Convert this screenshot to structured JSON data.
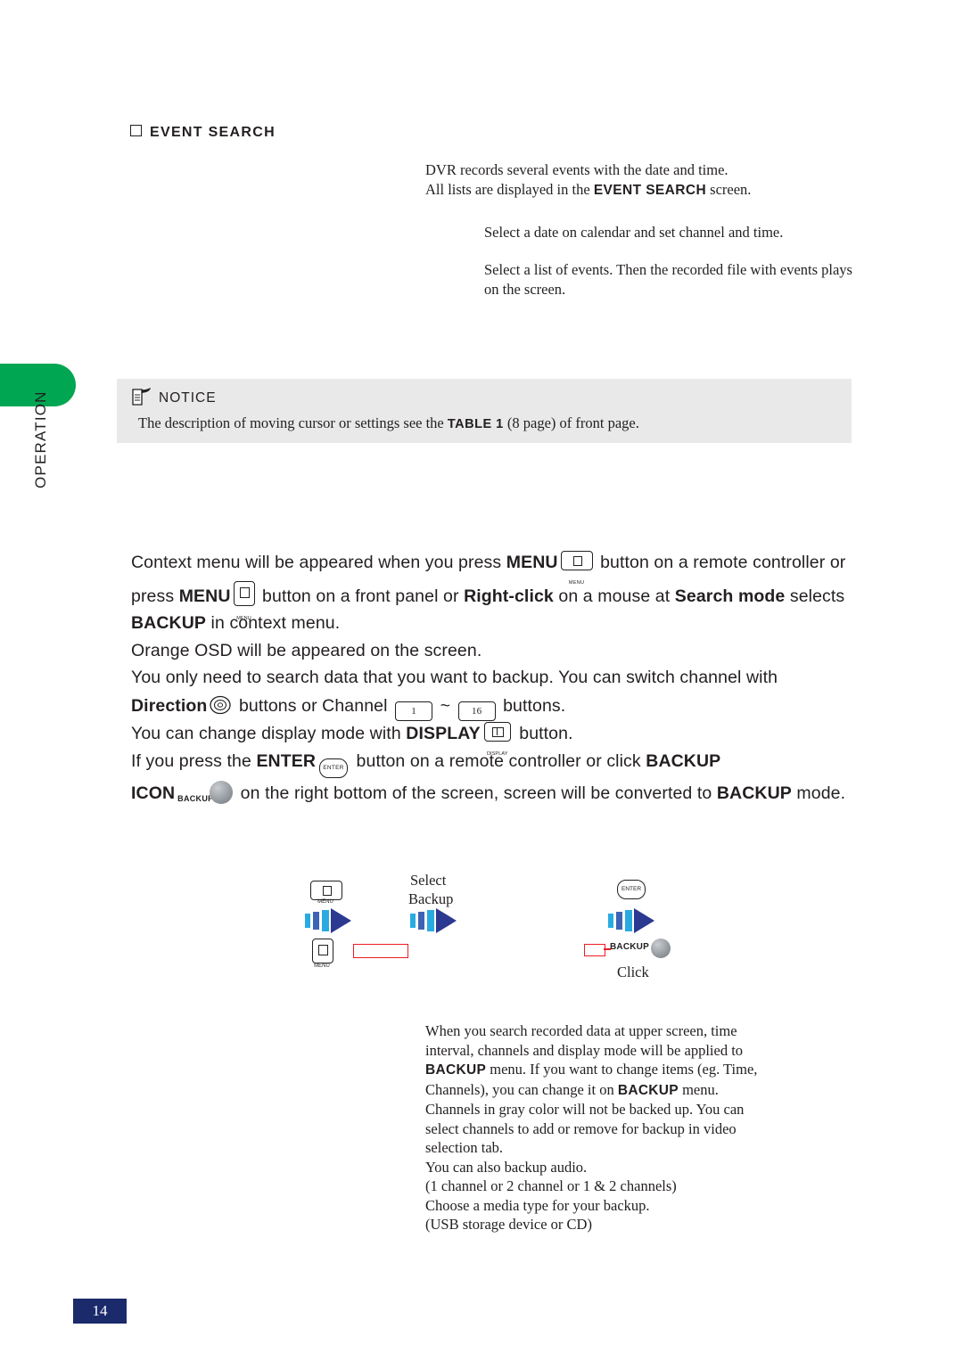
{
  "page": {
    "number": "14",
    "side_label": "OPERATION"
  },
  "section": {
    "heading": "EVENT SEARCH"
  },
  "intro": {
    "line1a": "DVR records several events with the date and time.",
    "line1b_pre": "All lists are displayed in the ",
    "line1b_bold": "EVENT SEARCH",
    "line1b_post": " screen.",
    "line2": "Select a date on calendar and set channel and time.",
    "line3": "Select a list of events. Then the recorded file with events plays on the screen."
  },
  "notice": {
    "title": "NOTICE",
    "text_pre": "The description of moving cursor or settings see the ",
    "text_bold": "TABLE 1",
    "text_post": " (8 page) of front page."
  },
  "body": {
    "seg1": "Context menu will be appeared when you press ",
    "menu_1": "MENU",
    "seg2": " button on a remote controller or press ",
    "menu_2": "MENU",
    "seg3": " button on a front panel or ",
    "rightclick": "Right-click",
    "seg4": " on a mouse at ",
    "searchmode": "Search mode",
    "seg5": " selects ",
    "backup_1": "BACKUP",
    "seg6": " in context menu.",
    "line_osd": "Orange OSD will be appeared on the screen.",
    "seg7": "You only need to search data that you want to backup. You can switch channel with ",
    "direction": "Direction",
    "seg8": " buttons or Channel ",
    "ch_low": "1",
    "seg9": " ~ ",
    "ch_high": "16",
    "seg10": " buttons.",
    "seg11": "You can change display mode with ",
    "display": "DISPLAY",
    "seg12": " button.",
    "seg13": "If you press the ",
    "enter": "ENTER",
    "seg14": " button on a remote controller or click ",
    "backup_2": "BACKUP",
    "seg15": "ICON",
    "backup_icon_label": "BACKUP",
    "seg16": " on the right bottom of the screen, screen will be converted to ",
    "backup_3": "BACKUP",
    "seg17": " mode."
  },
  "diagram": {
    "select": "Select",
    "backup": "Backup",
    "click": "Click",
    "menu_caption": "MENU",
    "enter_caption": "ENTER",
    "backup_label": "BACKUP"
  },
  "bottom": {
    "l1": "When you search recorded data at upper screen, time",
    "l2": "interval, channels and display mode will be applied to",
    "l3_bold": "BACKUP",
    "l3_mid": " menu. If you want to change items (eg. Time,",
    "l4_pre": "Channels), you can change it on ",
    "l4_bold": "BACKUP",
    "l4_post": " menu.",
    "l5": "Channels in gray color will not be backed up. You can",
    "l6": "select channels to add or remove for backup in video",
    "l7": "selection tab.",
    "l8": "You can also backup audio.",
    "l9": "(1 channel or 2 channel or 1 & 2 channels)",
    "l10": "Choose a media type for your backup.",
    "l11": "(USB storage device or CD)"
  },
  "colors": {
    "green_tab": "#00a651",
    "page_num_bg": "#1b2a6b",
    "notice_bg": "#e9e9e9",
    "arrow_blue": "#2b3990",
    "arrow_cyan": "#29abe2",
    "osd_red": "#ed1c24"
  }
}
